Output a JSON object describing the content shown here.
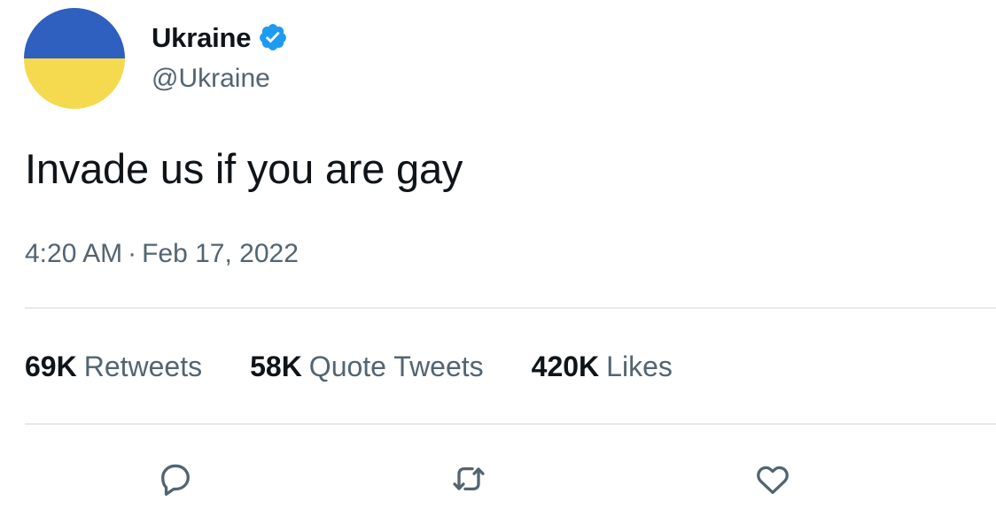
{
  "profile": {
    "display_name": "Ukraine",
    "handle": "@Ukraine",
    "verified": true,
    "avatar_colors": {
      "top": "#2f5fbf",
      "bottom": "#f5d94f"
    }
  },
  "tweet": {
    "text": "Invade us if you are gay",
    "time": "4:20 AM",
    "separator": "·",
    "date": "Feb 17, 2022"
  },
  "stats": {
    "retweets": {
      "count": "69K",
      "label": "Retweets"
    },
    "quote_tweets": {
      "count": "58K",
      "label": "Quote Tweets"
    },
    "likes": {
      "count": "420K",
      "label": "Likes"
    }
  },
  "actions": [
    {
      "icon": "reply-icon"
    },
    {
      "icon": "retweet-icon"
    },
    {
      "icon": "like-icon"
    }
  ],
  "colors": {
    "text_primary": "#0f1419",
    "text_secondary": "#536471",
    "verified": "#1d9bf0",
    "divider": "#e6e9ec"
  }
}
